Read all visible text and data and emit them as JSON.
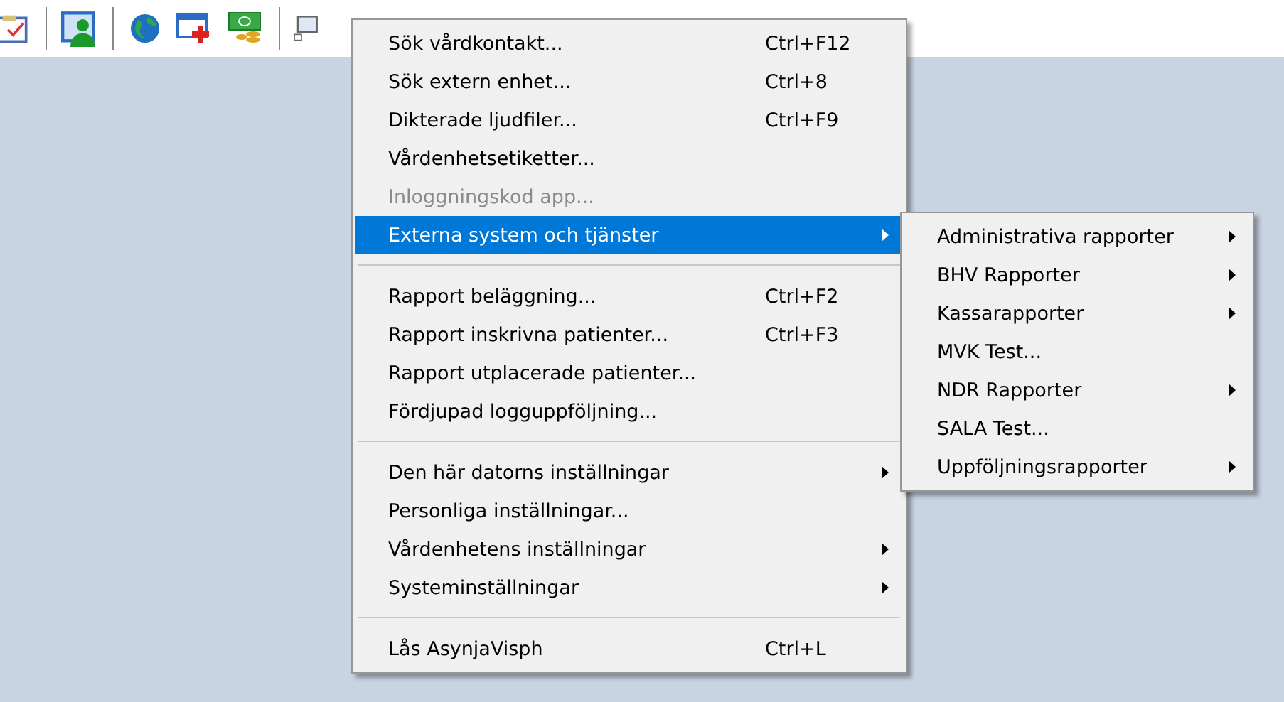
{
  "menu": {
    "items": [
      {
        "kind": "item",
        "label": "Sök vårdkontakt...",
        "shortcut": "Ctrl+F12",
        "disabled": false,
        "selected": false,
        "submenu": false
      },
      {
        "kind": "item",
        "label": "Sök extern enhet...",
        "shortcut": "Ctrl+8",
        "disabled": false,
        "selected": false,
        "submenu": false
      },
      {
        "kind": "item",
        "label": "Dikterade ljudfiler...",
        "shortcut": "Ctrl+F9",
        "disabled": false,
        "selected": false,
        "submenu": false
      },
      {
        "kind": "item",
        "label": "Vårdenhetsetiketter...",
        "disabled": false,
        "selected": false,
        "submenu": false
      },
      {
        "kind": "item",
        "label": "Inloggningskod app...",
        "disabled": true,
        "selected": false,
        "submenu": false
      },
      {
        "kind": "item",
        "label": "Externa system och tjänster",
        "disabled": false,
        "selected": true,
        "submenu": true
      },
      {
        "kind": "separator"
      },
      {
        "kind": "item",
        "label": "Rapport beläggning...",
        "shortcut": "Ctrl+F2",
        "disabled": false,
        "selected": false,
        "submenu": false
      },
      {
        "kind": "item",
        "label": "Rapport inskrivna patienter...",
        "shortcut": "Ctrl+F3",
        "disabled": false,
        "selected": false,
        "submenu": false
      },
      {
        "kind": "item",
        "label": "Rapport utplacerade patienter...",
        "disabled": false,
        "selected": false,
        "submenu": false
      },
      {
        "kind": "item",
        "label": "Fördjupad logguppföljning...",
        "disabled": false,
        "selected": false,
        "submenu": false
      },
      {
        "kind": "separator"
      },
      {
        "kind": "item",
        "label": "Den här datorns inställningar",
        "disabled": false,
        "selected": false,
        "submenu": true
      },
      {
        "kind": "item",
        "label": "Personliga inställningar...",
        "disabled": false,
        "selected": false,
        "submenu": false
      },
      {
        "kind": "item",
        "label": "Vårdenhetens inställningar",
        "disabled": false,
        "selected": false,
        "submenu": true
      },
      {
        "kind": "item",
        "label": "Systeminställningar",
        "disabled": false,
        "selected": false,
        "submenu": true
      },
      {
        "kind": "separator"
      },
      {
        "kind": "item",
        "label": "Lås AsynjaVisph",
        "shortcut": "Ctrl+L",
        "disabled": false,
        "selected": false,
        "submenu": false
      }
    ]
  },
  "submenu": {
    "items": [
      {
        "label": "Administrativa rapporter",
        "submenu": true
      },
      {
        "label": "BHV Rapporter",
        "submenu": true
      },
      {
        "label": "Kassarapporter",
        "submenu": true
      },
      {
        "label": "MVK Test...",
        "submenu": false
      },
      {
        "label": "NDR Rapporter",
        "submenu": true
      },
      {
        "label": "SALA Test...",
        "submenu": false
      },
      {
        "label": "Uppföljningsrapporter",
        "submenu": true
      }
    ]
  }
}
